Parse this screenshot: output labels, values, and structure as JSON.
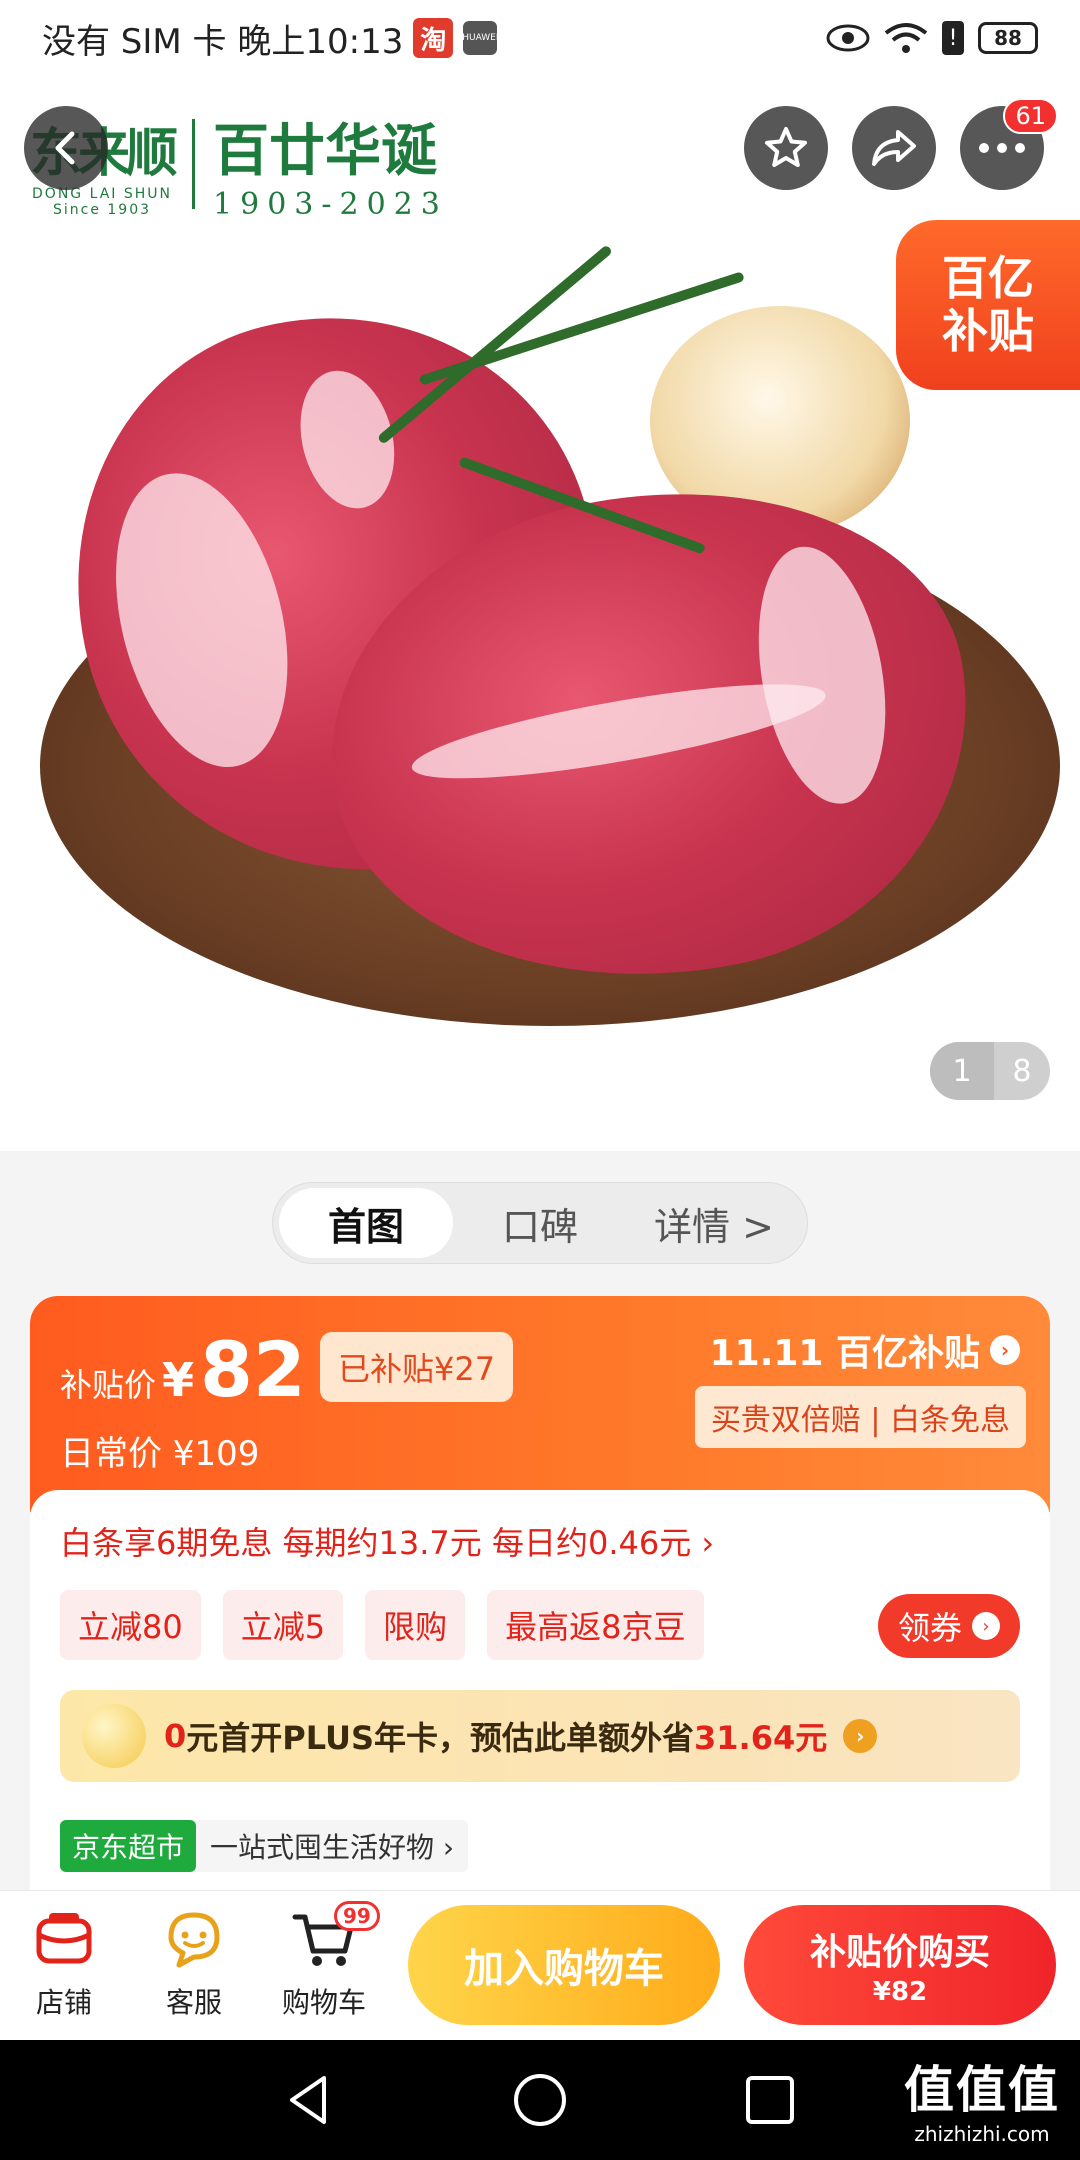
{
  "status_bar": {
    "left_text": "没有 SIM 卡 晚上10:13",
    "app_badge_1": "淘",
    "app_badge_2": "HUAWEI",
    "battery": "88"
  },
  "hero": {
    "brand_cn": "东来顺",
    "brand_en": "DONG LAI SHUN",
    "brand_since": "Since 1903",
    "anniversary": "百廿华诞",
    "years": "1903-2023",
    "more_badge": "61",
    "subsidy_tag_line1": "百亿",
    "subsidy_tag_line2": "补贴",
    "pager_current": "1",
    "pager_total": "8"
  },
  "tabs": [
    {
      "label": "首图",
      "active": true
    },
    {
      "label": "口碑",
      "active": false
    },
    {
      "label": "详情 >",
      "active": false
    }
  ],
  "price": {
    "label": "补贴价",
    "currency": "¥",
    "value": "82",
    "saved": "已补贴¥27",
    "regular": "日常价 ¥109",
    "campaign": "11.11 百亿补贴",
    "guarantee": "买贵双倍赔 | 白条免息"
  },
  "promo": {
    "installment": "白条享6期免息 每期约13.7元 每日约0.46元 ›",
    "chips": [
      "立减80",
      "立减5",
      "限购",
      "最高返8京豆"
    ],
    "coupon_btn": "领券",
    "plus_prefix": "0",
    "plus_text": "元首开PLUS年卡，预估此单额外省",
    "plus_amount": "31.64元",
    "store_tag": "京东超市",
    "store_desc": "一站式囤生活好物 ›"
  },
  "bottom_bar": {
    "store": "店铺",
    "service": "客服",
    "cart": "购物车",
    "cart_badge": "99",
    "add_cart": "加入购物车",
    "buy_main": "补贴价购买",
    "buy_sub": "¥82"
  },
  "watermark": {
    "big": "值值值",
    "small": "zhizhizhi.com"
  },
  "colors": {
    "accent": "#ff5b1f",
    "brand_green": "#1f7a3e",
    "buy_red": "#f0242a",
    "cart_yellow": "#ffab1a"
  }
}
